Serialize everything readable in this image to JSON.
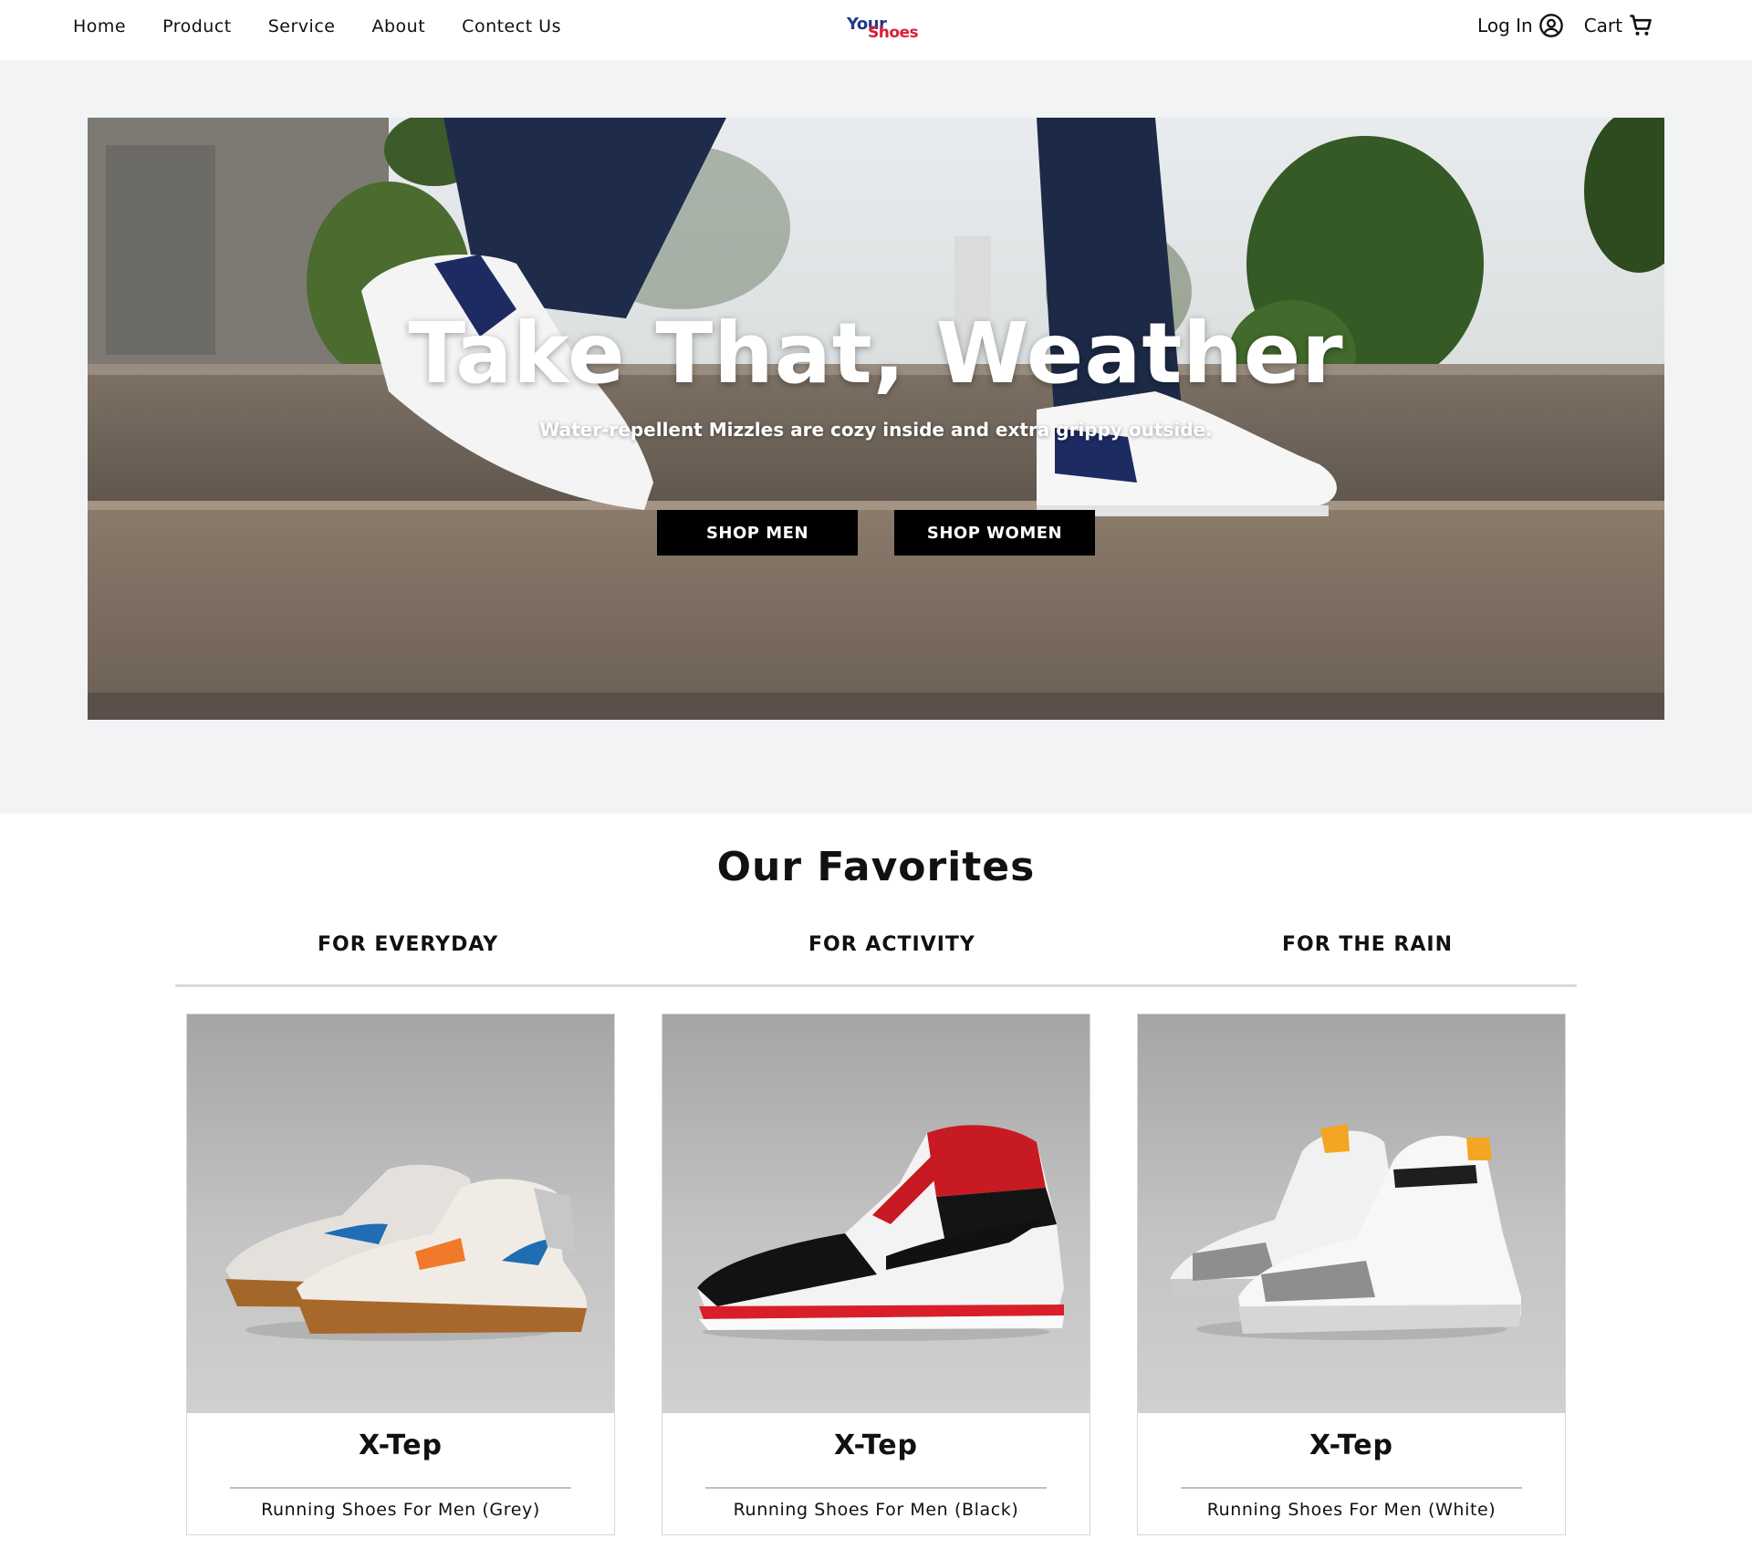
{
  "nav": {
    "links": [
      "Home",
      "Product",
      "Service",
      "About",
      "Contect Us"
    ],
    "logo": {
      "line1": "Your",
      "line2": "Shoes"
    },
    "login_label": "Log In",
    "cart_label": "Cart"
  },
  "hero": {
    "title": "Take That, Weather",
    "subtitle": "Water-repellent Mizzles are cozy inside and extra grippy outside.",
    "btn_men": "SHOP MEN",
    "btn_women": "SHOP WOMEN"
  },
  "favorites": {
    "title": "Our Favorites",
    "tabs": [
      "FOR EVERYDAY",
      "FOR ACTIVITY",
      "FOR THE RAIN"
    ],
    "products": [
      {
        "name": "X-Tep",
        "desc": "Running Shoes For Men (Grey)"
      },
      {
        "name": "X-Tep",
        "desc": "Running Shoes For Men (Black)"
      },
      {
        "name": "X-Tep",
        "desc": "Running Shoes For Men (White)"
      }
    ]
  },
  "colors": {
    "logo_blue": "#1f3a8a",
    "logo_red": "#d81e3a",
    "button_bg": "#000000",
    "hero_band": "#f2f3f5"
  },
  "icons": {
    "login": "user-circle-icon",
    "cart": "cart-icon"
  }
}
